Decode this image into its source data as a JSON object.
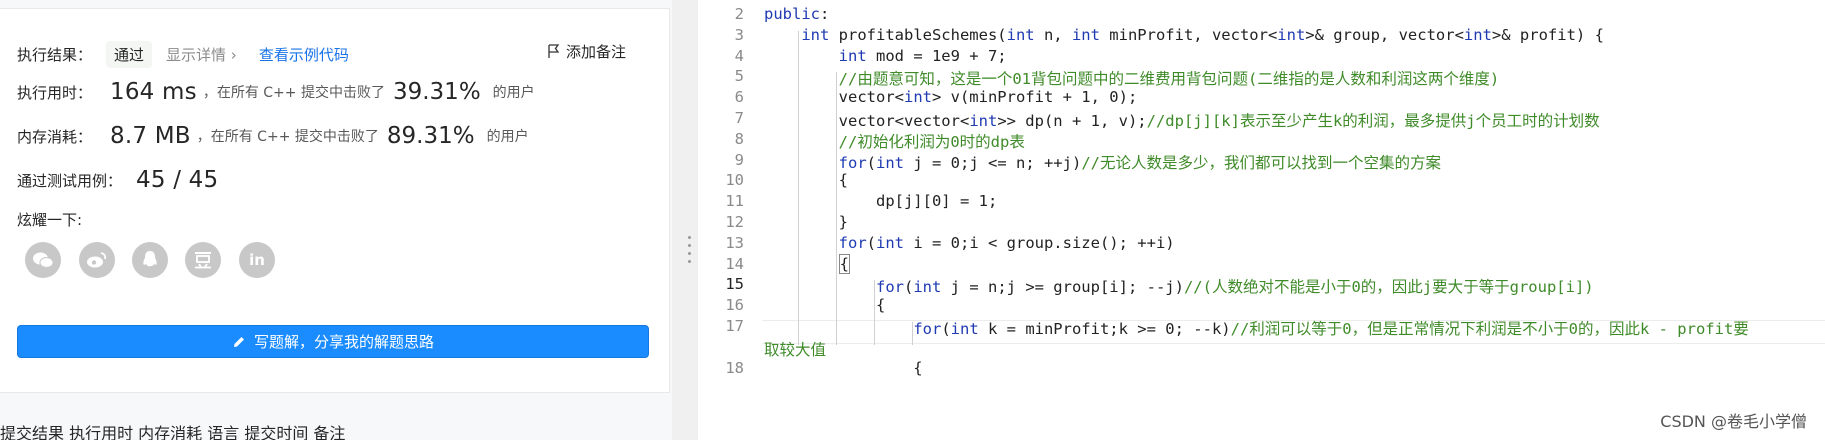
{
  "result": {
    "label": "执行结果：",
    "status": "通过",
    "details_link": "显示详情 ›",
    "sample_code_link": "查看示例代码",
    "add_note": "添加备注"
  },
  "runtime": {
    "label": "执行用时：",
    "value": "164 ms",
    "text": "，在所有 C++ 提交中击败了",
    "percent": "39.31%",
    "suffix": "的用户"
  },
  "memory": {
    "label": "内存消耗：",
    "value": "8.7 MB",
    "text": "，在所有 C++ 提交中击败了",
    "percent": "89.31%",
    "suffix": "的用户"
  },
  "tests": {
    "label": "通过测试用例：",
    "value": "45 / 45"
  },
  "share": {
    "label": "炫耀一下:",
    "icons": [
      "wechat-icon",
      "weibo-icon",
      "qq-icon",
      "douban-icon",
      "linkedin-icon"
    ],
    "linkedin_text": "in"
  },
  "solution_button": "写题解，分享我的解题思路",
  "bottom_row": "提交结果    执行用时    内存消耗    语言    提交时间                备注",
  "editor": {
    "current_line": 15,
    "lines": [
      {
        "n": "2",
        "html": "<span class='kw'>public</span>:"
      },
      {
        "n": "3",
        "html": "    <span class='ty'>int</span> profitableSchemes(<span class='ty'>int</span> n, <span class='ty'>int</span> minProfit, vector&lt;<span class='ty'>int</span>&gt;&amp; group, vector&lt;<span class='ty'>int</span>&gt;&amp; profit) {"
      },
      {
        "n": "4",
        "html": "        <span class='ty'>int</span> mod = 1e9 + 7;"
      },
      {
        "n": "5",
        "html": "        <span class='cm'>//由题意可知，这是一个01背包问题中的二维费用背包问题(二维指的是人数和利润这两个维度)</span>"
      },
      {
        "n": "6",
        "html": "        vector&lt;<span class='ty'>int</span>&gt; v(minProfit + 1, 0);"
      },
      {
        "n": "7",
        "html": "        vector&lt;vector&lt;<span class='ty'>int</span>&gt;&gt; dp(n + 1, v);<span class='cm'>//dp[j][k]表示至少产生k的利润，最多提供j个员工时的计划数</span>"
      },
      {
        "n": "8",
        "html": "        <span class='cm'>//初始化利润为0时的dp表</span>"
      },
      {
        "n": "9",
        "html": "        <span class='kw'>for</span>(<span class='ty'>int</span> j = 0;j &lt;= n; ++j)<span class='cm'>//无论人数是多少，我们都可以找到一个空集的方案</span>"
      },
      {
        "n": "10",
        "html": "        {"
      },
      {
        "n": "11",
        "html": "            dp[j][0] = 1;"
      },
      {
        "n": "12",
        "html": "        }"
      },
      {
        "n": "13",
        "html": "        <span class='kw'>for</span>(<span class='ty'>int</span> i = 0;i &lt; group.size(); ++i)"
      },
      {
        "n": "14",
        "html": "        <span class='cursor-box'>{</span>"
      },
      {
        "n": "15",
        "html": "            <span class='kw'>for</span>(<span class='ty'>int</span> j = n;j &gt;= group[i]; --j)<span class='cm'>//(人数绝对不能是小于0的，因此j要大于等于group[i])</span>"
      },
      {
        "n": "16",
        "html": "            {"
      },
      {
        "n": "17",
        "html": "                <span class='kw'>for</span>(<span class='ty'>int</span> k = minProfit;k &gt;= 0; --k)<span class='cm'>//利润可以等于0，但是正常情况下利润是不小于0的，因此k - profit要</span>"
      },
      {
        "n": "",
        "html": "<span class='cm'>取较大值</span>"
      },
      {
        "n": "18",
        "html": "                {"
      }
    ]
  },
  "watermark": "CSDN @卷毛小学僧",
  "colors": {
    "accent": "#1a8cff",
    "link": "#1a73e8",
    "comment": "#3f8b29",
    "keyword": "#1f3ab2"
  }
}
